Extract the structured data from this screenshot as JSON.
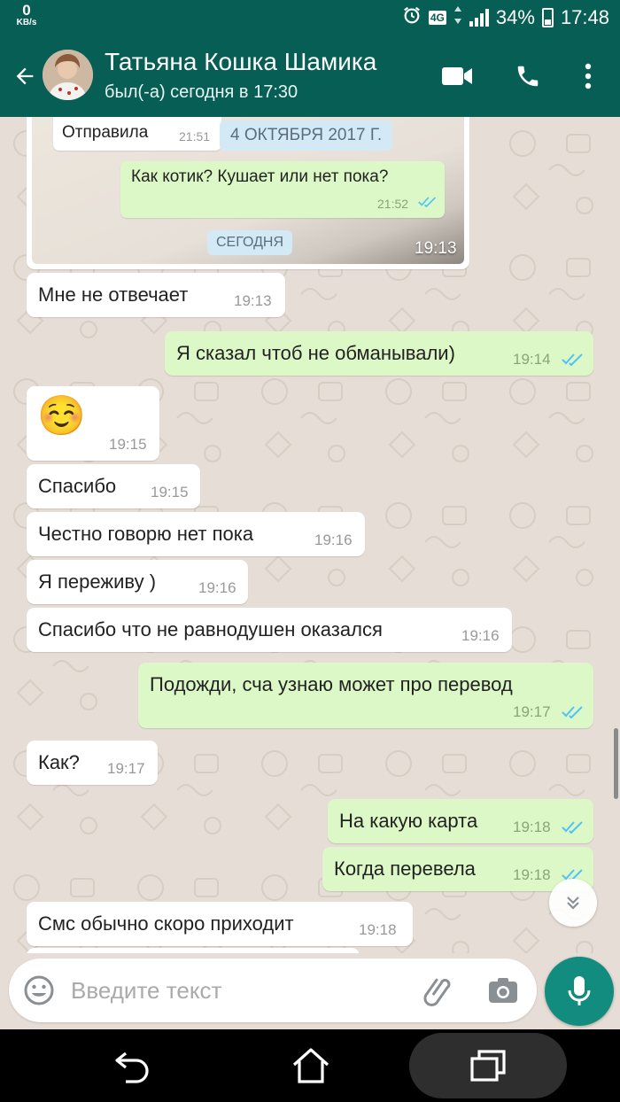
{
  "status_bar": {
    "speed_value": "0",
    "speed_unit": "KB/s",
    "network": "4G",
    "battery": "34%",
    "time": "17:48"
  },
  "header": {
    "contact_name": "Татьяна Кошка Шамика",
    "last_seen": "был(-а) сегодня в 17:30"
  },
  "image_message": {
    "inner_in_text": "Отправила",
    "inner_in_time": "21:51",
    "inner_date": "4 ОКТЯБРЯ 2017 Г.",
    "inner_out_text": "Как котик? Кушает или нет пока?",
    "inner_out_time": "21:52",
    "inner_today": "СЕГОДНЯ",
    "time": "19:13"
  },
  "messages": [
    {
      "dir": "in",
      "text": "Мне не отвечает",
      "time": "19:13"
    },
    {
      "dir": "out",
      "text": "Я сказал чтоб не обманывали)",
      "time": "19:14"
    },
    {
      "dir": "in",
      "text": "☺️",
      "time": "19:15"
    },
    {
      "dir": "in",
      "text": "Спасибо",
      "time": "19:15"
    },
    {
      "dir": "in",
      "text": "Честно говорю нет пока",
      "time": "19:16"
    },
    {
      "dir": "in",
      "text": "Я переживу )",
      "time": "19:16"
    },
    {
      "dir": "in",
      "text": "Спасибо что не равнодушен оказался",
      "time": "19:16"
    },
    {
      "dir": "out",
      "text": "Подожди, сча узнаю может про перевод",
      "time": "19:17"
    },
    {
      "dir": "in",
      "text": "Как?",
      "time": "19:17"
    },
    {
      "dir": "out",
      "text": "На какую карта",
      "time": "19:18"
    },
    {
      "dir": "out",
      "text": "Когда перевела",
      "time": "19:18"
    },
    {
      "dir": "in",
      "text": "Смс обычно скоро приходит",
      "time": "19:18"
    }
  ],
  "input": {
    "placeholder": "Введите текст"
  },
  "colors": {
    "header": "#075e54",
    "outgoing_bubble": "#dcf8c6",
    "incoming_bubble": "#ffffff",
    "read_ticks": "#4fc3f7",
    "mic_button": "#128c7e",
    "chat_background": "#e6ded6"
  },
  "icons": {
    "back": "arrow-left-icon",
    "video": "video-call-icon",
    "call": "phone-icon",
    "menu": "more-vertical-icon",
    "emoji": "emoji-icon",
    "attach": "paperclip-icon",
    "camera": "camera-icon",
    "mic": "mic-icon",
    "scroll_down": "chevron-double-down-icon",
    "nav_back": "nav-back-icon",
    "nav_home": "nav-home-icon",
    "nav_recents": "nav-recents-icon"
  }
}
